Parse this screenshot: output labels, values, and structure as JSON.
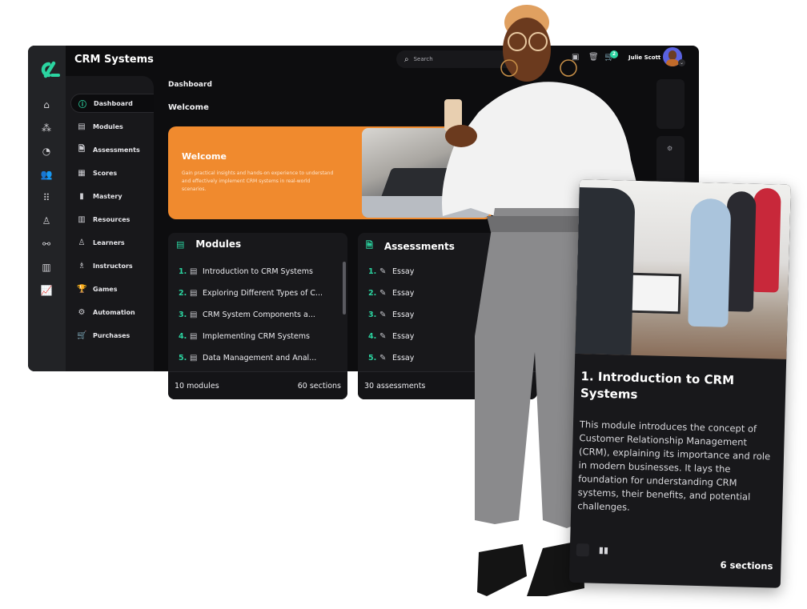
{
  "app": {
    "title": "CRM Systems",
    "accent_color": "#2bd4a0",
    "hero_color": "#f08a2e"
  },
  "rail": {
    "icons": [
      "home-icon",
      "modules-cluster-icon",
      "chart-pie-icon",
      "users-icon",
      "grid-icon",
      "user-icon",
      "network-icon",
      "library-icon",
      "line-chart-icon"
    ]
  },
  "sidebar": {
    "items": [
      {
        "label": "Dashboard",
        "icon": "info-circle-icon",
        "active": true
      },
      {
        "label": "Modules",
        "icon": "book-icon"
      },
      {
        "label": "Assessments",
        "icon": "document-check-icon"
      },
      {
        "label": "Scores",
        "icon": "table-icon"
      },
      {
        "label": "Mastery",
        "icon": "bar-chart-icon"
      },
      {
        "label": "Resources",
        "icon": "books-icon"
      },
      {
        "label": "Learners",
        "icon": "learner-icon"
      },
      {
        "label": "Instructors",
        "icon": "instructor-icon"
      },
      {
        "label": "Games",
        "icon": "trophy-icon"
      },
      {
        "label": "Automation",
        "icon": "gears-icon"
      },
      {
        "label": "Purchases",
        "icon": "cart-icon"
      }
    ]
  },
  "header": {
    "search_placeholder": "Search",
    "cart_count": "2",
    "user_name": "Julie Scott"
  },
  "main": {
    "breadcrumb": "Dashboard",
    "heading": "Welcome",
    "hero": {
      "title": "Welcome",
      "description": "Gain practical insights and hands-on experience to understand and effectively implement CRM systems in real-world scenarios."
    },
    "modules": {
      "title": "Modules",
      "items": [
        {
          "num": "1.",
          "label": "Introduction to CRM Systems"
        },
        {
          "num": "2.",
          "label": "Exploring Different Types of C..."
        },
        {
          "num": "3.",
          "label": "CRM System Components a..."
        },
        {
          "num": "4.",
          "label": "Implementing CRM Systems"
        },
        {
          "num": "5.",
          "label": "Data Management and Anal..."
        }
      ],
      "count": "10 modules",
      "sections": "60 sections"
    },
    "assessments": {
      "title": "Assessments",
      "items": [
        {
          "num": "1.",
          "label": "Essay"
        },
        {
          "num": "2.",
          "label": "Essay"
        },
        {
          "num": "3.",
          "label": "Essay"
        },
        {
          "num": "4.",
          "label": "Essay"
        },
        {
          "num": "5.",
          "label": "Essay"
        }
      ],
      "count": "30 assessments"
    }
  },
  "detail_card": {
    "title": "1. Introduction to CRM Systems",
    "description": "This module introduces the concept of Customer Relationship Management (CRM), explaining its importance and role in modern businesses. It lays the foundation for understanding CRM systems, their benefits, and potential challenges.",
    "sections": "6 sections"
  }
}
